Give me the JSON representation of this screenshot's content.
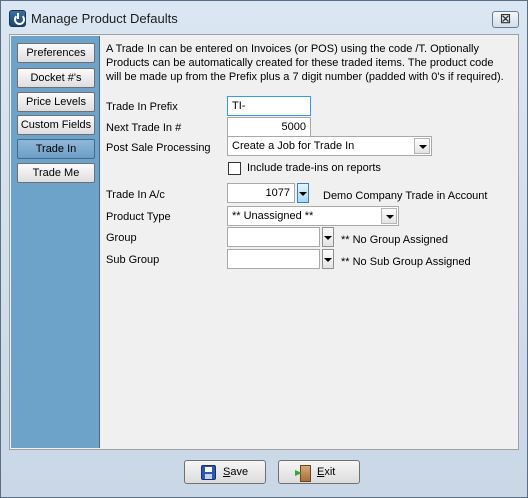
{
  "window": {
    "title": "Manage Product Defaults",
    "close_label": "☒"
  },
  "sidebar": {
    "items": [
      {
        "label": "Preferences"
      },
      {
        "label": "Docket #'s"
      },
      {
        "label": "Price Levels"
      },
      {
        "label": "Custom Fields"
      },
      {
        "label": "Trade In"
      },
      {
        "label": "Trade Me"
      }
    ],
    "active": "Trade In"
  },
  "main": {
    "description": "A Trade In can be entered on Invoices (or POS) using the code /T.  Optionally Products can be automatically created for these traded items.  The product code will be made up from the Prefix plus a 7 digit number (padded with 0's if required).",
    "trade_in_prefix": {
      "label": "Trade In Prefix",
      "value": "TI-"
    },
    "next_trade_in": {
      "label": "Next Trade In #",
      "value": "5000"
    },
    "post_sale_processing": {
      "label": "Post Sale Processing",
      "value": "Create a Job for Trade In"
    },
    "include_trade_ins": {
      "label": "Include trade-ins on reports",
      "checked": false
    },
    "trade_in_ac": {
      "label": "Trade In A/c",
      "value": "1077",
      "description": "Demo Company Trade in Account"
    },
    "product_type": {
      "label": "Product Type",
      "value": "** Unassigned **"
    },
    "group": {
      "label": "Group",
      "value": "",
      "description": "** No Group Assigned"
    },
    "sub_group": {
      "label": "Sub Group",
      "value": "",
      "description": "** No Sub Group Assigned"
    }
  },
  "footer": {
    "save": {
      "accel": "S",
      "rest": "ave"
    },
    "exit": {
      "accel": "E",
      "rest": "xit"
    }
  },
  "icons": [
    "app-icon",
    "close-icon",
    "save-icon",
    "exit-icon",
    "chevron-down-icon"
  ]
}
